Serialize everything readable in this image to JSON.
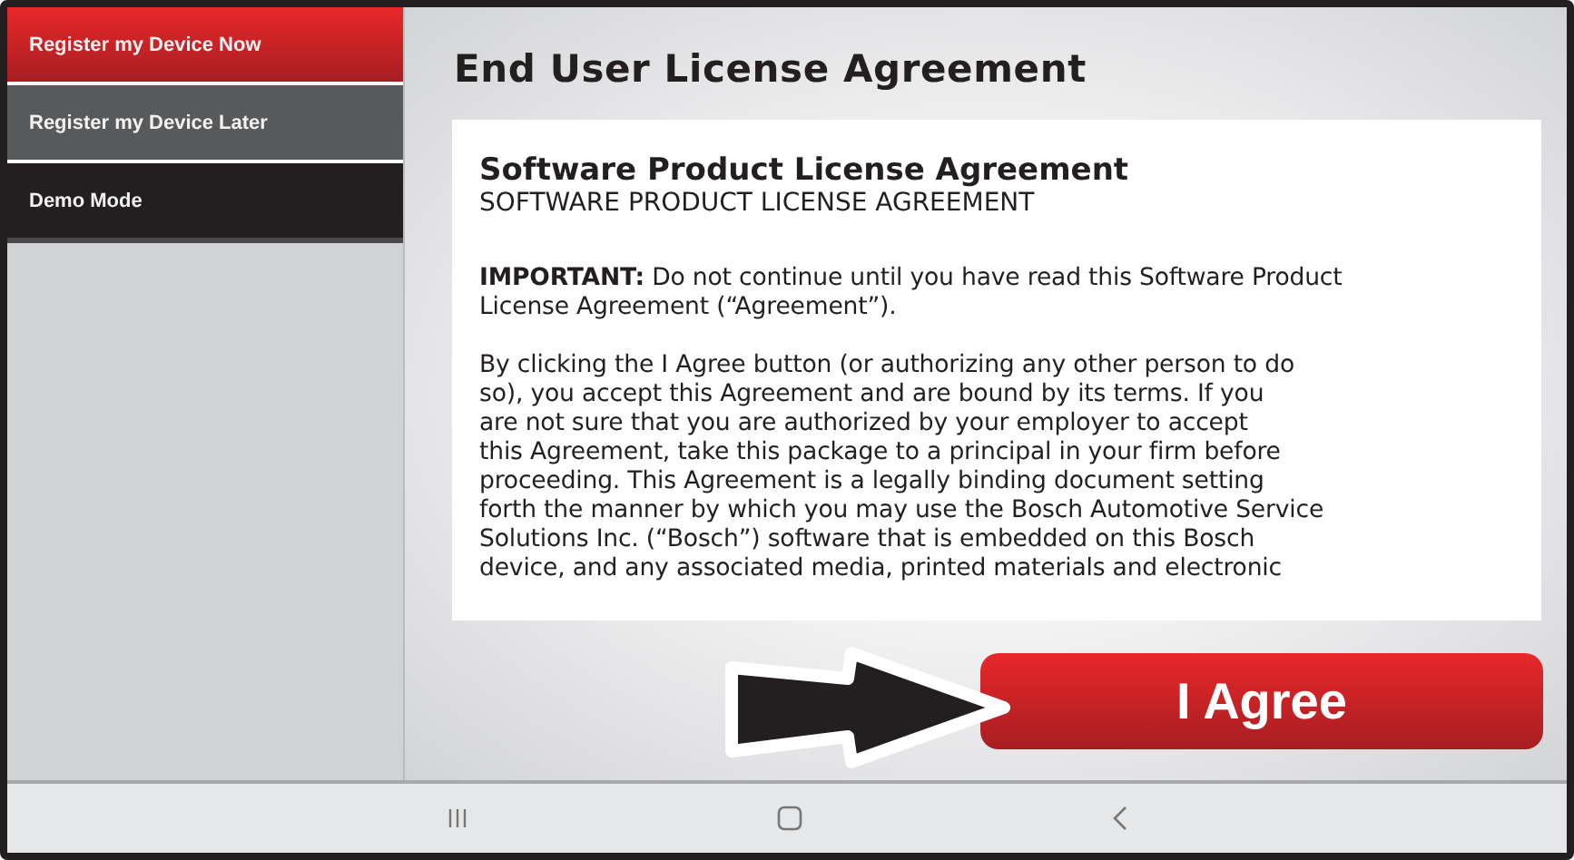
{
  "sidebar": {
    "items": [
      {
        "label": "Register my Device Now",
        "selected": true
      },
      {
        "label": "Register my Device Later",
        "selected": false
      },
      {
        "label": "Demo Mode",
        "selected": false
      }
    ]
  },
  "title": "End User License Agreement",
  "agreement": {
    "heading": "Software Product License Agreement",
    "subheading": "SOFTWARE PRODUCT LICENSE AGREEMENT",
    "paragraphs": [
      "**IMPORTANT:**  Do not continue until you have read this Software Product\nLicense Agreement (“Agreement”).",
      "By clicking the I Agree button (or authorizing any other person to do\nso), you accept this Agreement and are bound by its terms. If you\nare not sure that you are authorized by your employer to accept\nthis Agreement, take this package to a principal in your firm before\nproceeding. This Agreement is a legally binding document setting\nforth the manner by which you may use the Bosch Automotive Service\nSolutions Inc. (“Bosch”) software that is embedded on this Bosch\ndevice, and any associated media, printed materials and electronic"
    ]
  },
  "agree_button": "I Agree"
}
